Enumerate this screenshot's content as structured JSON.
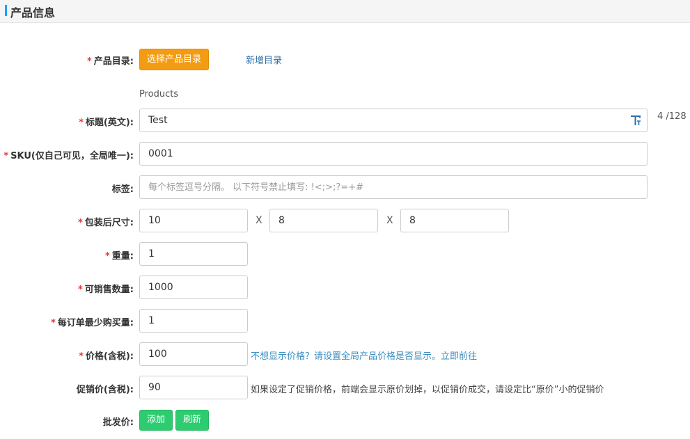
{
  "header": {
    "title": "产品信息"
  },
  "required_mark": "*",
  "catalog": {
    "label": "产品目录:",
    "select_button": "选择产品目录",
    "add_link": "新增目录",
    "selected": "Products"
  },
  "title_en": {
    "label": "标题(英文):",
    "value": "Test",
    "counter": "4 /128",
    "icon": "text-format-icon"
  },
  "sku": {
    "label": "SKU(仅自己可见，全局唯一):",
    "value": "0001"
  },
  "tags": {
    "label": "标签:",
    "placeholder": "每个标签逗号分隔。 以下符号禁止填写: !<;>;?=+#"
  },
  "package_size": {
    "label": "包装后尺寸:",
    "length": "10",
    "width": "8",
    "height": "8",
    "separator": "X"
  },
  "weight": {
    "label": "重量:",
    "value": "1"
  },
  "stock": {
    "label": "可销售数量:",
    "value": "1000"
  },
  "min_order": {
    "label": "每订单最少购买量:",
    "value": "1"
  },
  "price": {
    "label": "价格(含税):",
    "value": "100",
    "hint": "不想显示价格？请设置全局产品价格是否显示。立即前往"
  },
  "promo_price": {
    "label": "促销价(含税):",
    "value": "90",
    "hint": "如果设定了促销价格，前端会显示原价划掉，以促销价成交，请设定比“原价”小的促销价"
  },
  "wholesale": {
    "label": "批发价:",
    "add_button": "添加",
    "refresh_button": "刷新"
  }
}
